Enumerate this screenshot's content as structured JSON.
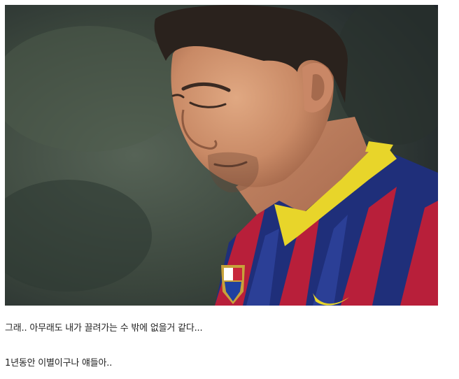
{
  "captions": [
    "그래.. 아무래도 내가 끌려가는 수 밖에 없을거 같다...",
    "1년동안 이별이구나 얘들아.."
  ],
  "colors": {
    "jersey_blue": "#1f2f7a",
    "jersey_red": "#b81f3a",
    "collar_yellow": "#e8d52a",
    "background_dark": "#2e3630"
  }
}
